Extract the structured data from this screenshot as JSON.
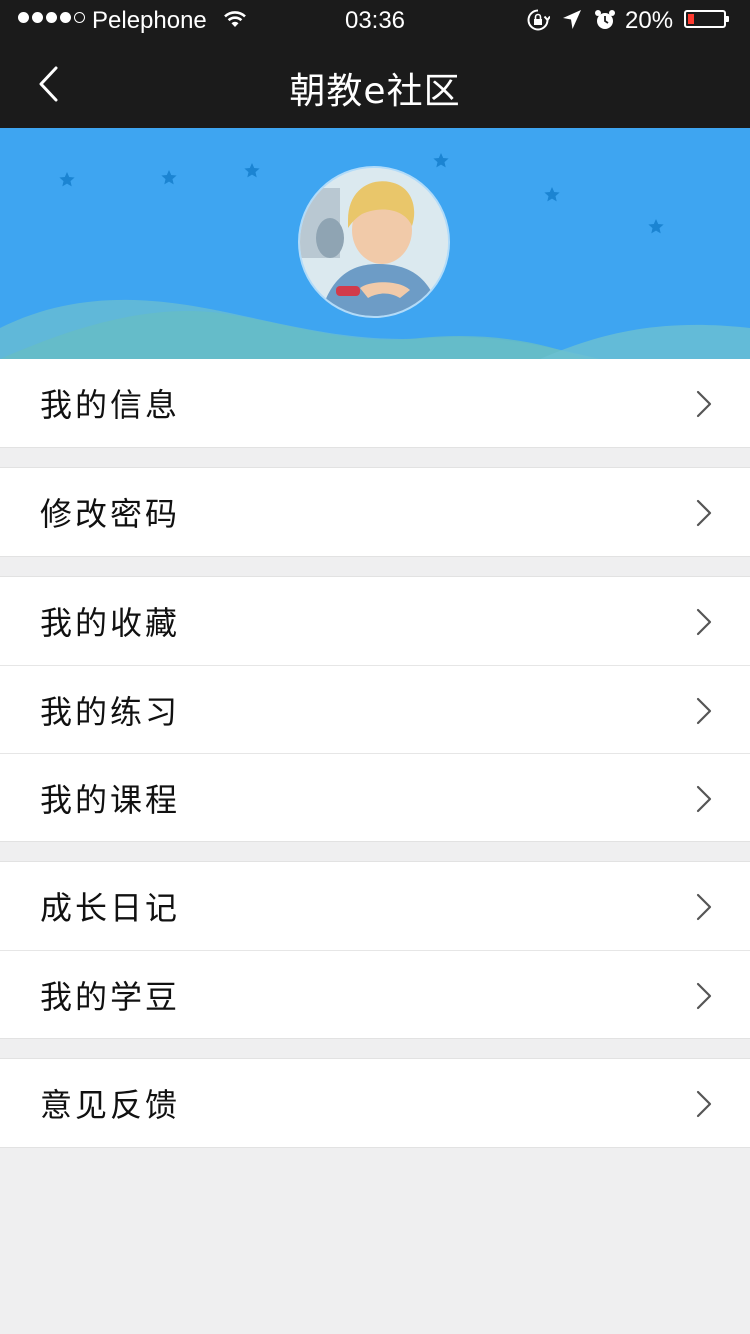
{
  "status_bar": {
    "carrier": "Pelephone",
    "time": "03:36",
    "battery": "20%",
    "battery_level": 0.2,
    "icons": [
      "signal-dots",
      "wifi-icon",
      "rotation-lock-icon",
      "location-arrow-icon",
      "alarm-icon",
      "battery-icon"
    ]
  },
  "nav": {
    "title": "朝教e社区",
    "back_icon": "chevron-left-icon"
  },
  "banner": {
    "background": "#3ea5f1",
    "avatar_desc": "user-avatar"
  },
  "menu_groups": [
    {
      "items": [
        {
          "label": "我的信息"
        }
      ]
    },
    {
      "items": [
        {
          "label": "修改密码"
        }
      ]
    },
    {
      "items": [
        {
          "label": "我的收藏"
        },
        {
          "label": "我的练习"
        },
        {
          "label": "我的课程"
        }
      ]
    },
    {
      "items": [
        {
          "label": "成长日记"
        },
        {
          "label": "我的学豆"
        }
      ]
    },
    {
      "items": [
        {
          "label": "意见反馈"
        }
      ]
    }
  ],
  "colors": {
    "bar": "#1b1b1b",
    "banner": "#3ea5f1",
    "page_bg": "#efeff0",
    "battery_low": "#ff3b30"
  }
}
